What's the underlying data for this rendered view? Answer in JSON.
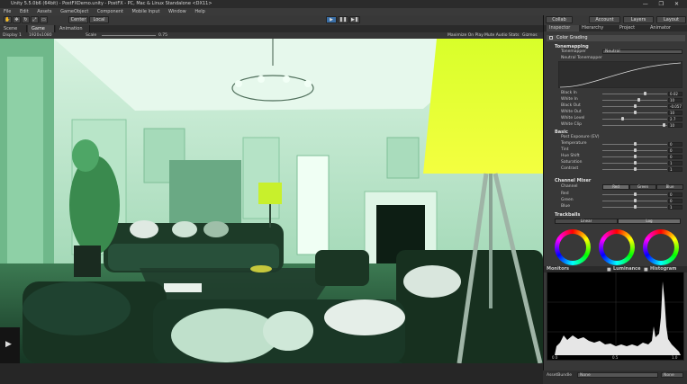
{
  "window": {
    "title": "Unity 5.5.0b6 (64bit) - PostFXDemo.unity - PostFX - PC, Mac & Linux Standalone <DX11>",
    "controls": "—  ❐  ✕"
  },
  "menu": [
    "File",
    "Edit",
    "Assets",
    "GameObject",
    "Component",
    "Mobile Input",
    "Window",
    "Help"
  ],
  "toolbar": {
    "center_label": "Center",
    "local_label": "Local",
    "collab_label": "Collab",
    "account_label": "Account",
    "layers_label": "Layers",
    "layout_label": "Layout"
  },
  "tabs": {
    "scene": "Scene",
    "game": "Game",
    "animation": "Animation"
  },
  "gamebar": {
    "display": "Display 1",
    "resolution": "1920x1080",
    "scale_label": "Scale",
    "scale_value": "0.75",
    "maximize": "Maximize On Play",
    "mute": "Mute Audio",
    "stats": "Stats",
    "gizmos": "Gizmos"
  },
  "right_tabs": {
    "inspector": "Inspector",
    "hierarchy": "Hierarchy",
    "project": "Project",
    "animator": "Animator"
  },
  "inspector": {
    "component": "Color Grading",
    "tonemapping": {
      "header": "Tonemapping",
      "tonemapper_label": "Tonemapper",
      "tonemapper_value": "Neutral",
      "curve_label": "Neutral Tonemapper",
      "params": [
        {
          "label": "Black In",
          "value": "0.02",
          "pos": 0.65
        },
        {
          "label": "White In",
          "value": "10",
          "pos": 0.55
        },
        {
          "label": "Black Out",
          "value": "-0.057",
          "pos": 0.5
        },
        {
          "label": "White Out",
          "value": "10",
          "pos": 0.5
        },
        {
          "label": "White Level",
          "value": "2.7",
          "pos": 0.3
        },
        {
          "label": "White Clip",
          "value": "10",
          "pos": 0.95
        }
      ]
    },
    "basic": {
      "header": "Basic",
      "post_exposure": "Post Exposure (EV)",
      "params": [
        {
          "label": "Temperature",
          "value": "0",
          "pos": 0.5
        },
        {
          "label": "Tint",
          "value": "0",
          "pos": 0.5
        },
        {
          "label": "Hue Shift",
          "value": "0",
          "pos": 0.5
        },
        {
          "label": "Saturation",
          "value": "1",
          "pos": 0.5
        },
        {
          "label": "Contrast",
          "value": "1",
          "pos": 0.5
        }
      ]
    },
    "mixer": {
      "header": "Channel Mixer",
      "channel_label": "Channel",
      "channels": [
        "Red",
        "Green",
        "Blue"
      ],
      "params": [
        {
          "label": "Red",
          "value": "0",
          "pos": 0.5
        },
        {
          "label": "Green",
          "value": "0",
          "pos": 0.5
        },
        {
          "label": "Blue",
          "value": "1",
          "pos": 0.5
        }
      ]
    },
    "trackballs": {
      "header": "Trackballs",
      "modes": [
        "Linear",
        "Log"
      ]
    }
  },
  "monitors": {
    "label": "Monitors",
    "luminance": "Luminance",
    "histogram": "Histogram",
    "ticks": [
      "0.0",
      "0.5",
      "1.0"
    ]
  },
  "assetbundle": {
    "label": "AssetBundle",
    "name": "None",
    "variant": "None"
  }
}
